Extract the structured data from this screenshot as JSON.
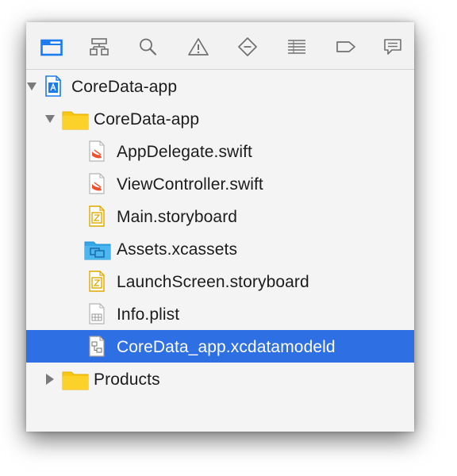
{
  "toolbar": {
    "icons": [
      {
        "name": "project-navigator-icon",
        "color": "#1d7bf0",
        "active": true
      },
      {
        "name": "symbol-navigator-icon"
      },
      {
        "name": "find-navigator-icon"
      },
      {
        "name": "issue-navigator-icon"
      },
      {
        "name": "test-navigator-icon"
      },
      {
        "name": "debug-navigator-icon"
      },
      {
        "name": "breakpoint-navigator-icon"
      },
      {
        "name": "report-navigator-icon"
      }
    ]
  },
  "tree": {
    "items": [
      {
        "label": "CoreData-app",
        "kind": "project",
        "expanded": true,
        "depth": 0
      },
      {
        "label": "CoreData-app",
        "kind": "folder",
        "expanded": true,
        "depth": 1
      },
      {
        "label": "AppDelegate.swift",
        "kind": "swift-file",
        "depth": 2
      },
      {
        "label": "ViewController.swift",
        "kind": "swift-file",
        "depth": 2
      },
      {
        "label": "Main.storyboard",
        "kind": "storyboard-file",
        "depth": 2
      },
      {
        "label": "Assets.xcassets",
        "kind": "asset-catalog",
        "depth": 2
      },
      {
        "label": "LaunchScreen.storyboard",
        "kind": "storyboard-file",
        "depth": 2
      },
      {
        "label": "Info.plist",
        "kind": "plist-file",
        "depth": 2
      },
      {
        "label": "CoreData_app.xcdatamodeld",
        "kind": "datamodel-file",
        "depth": 2,
        "selected": true
      },
      {
        "label": "Products",
        "kind": "folder",
        "expanded": false,
        "depth": 1
      }
    ]
  },
  "colors": {
    "selection": "#2f6fe4",
    "folder": "#f8c613",
    "accent": "#1d7bf0",
    "swift": "#f0512c",
    "storyboard": "#e0a800",
    "assets": "#35a7e6"
  }
}
